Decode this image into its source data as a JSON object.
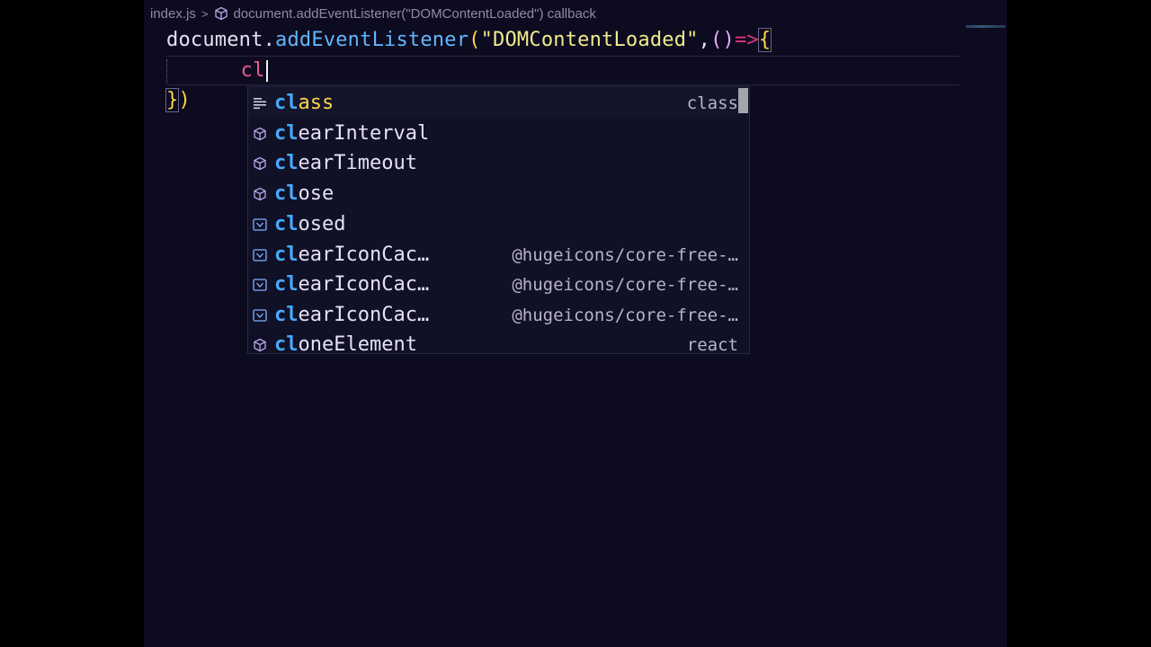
{
  "breadcrumb": {
    "file": "index.js",
    "symbol": "document.addEventListener(\"DOMContentLoaded\") callback"
  },
  "code": {
    "line1": {
      "obj": "document",
      "dot": ".",
      "fn": "addEventListener",
      "open": "(",
      "str": "\"DOMContentLoaded\"",
      "comma": ",",
      "params": "()",
      "arrow": "=>",
      "brace": "{"
    },
    "line2": {
      "typed": "cl"
    },
    "line3": {
      "brace": "}",
      "close": ")"
    }
  },
  "suggestions": [
    {
      "match": "cl",
      "rest": "ass",
      "detail": "class",
      "icon": "keyword-snippet-icon",
      "selected": true
    },
    {
      "match": "cl",
      "rest": "earInterval",
      "detail": "",
      "icon": "method-cube-icon"
    },
    {
      "match": "cl",
      "rest": "earTimeout",
      "detail": "",
      "icon": "method-cube-icon"
    },
    {
      "match": "cl",
      "rest": "ose",
      "detail": "",
      "icon": "method-cube-icon"
    },
    {
      "match": "cl",
      "rest": "osed",
      "detail": "",
      "icon": "variable-icon"
    },
    {
      "match": "cl",
      "rest": "earIconCac…",
      "detail": "@hugeicons/core-free-…",
      "icon": "variable-icon"
    },
    {
      "match": "cl",
      "rest": "earIconCac…",
      "detail": "@hugeicons/core-free-…",
      "icon": "variable-icon"
    },
    {
      "match": "cl",
      "rest": "earIconCac…",
      "detail": "@hugeicons/core-free-…",
      "icon": "variable-icon"
    },
    {
      "match": "cl",
      "rest": "oneElement",
      "detail": "react",
      "icon": "method-cube-icon"
    }
  ],
  "colors": {
    "editor_bg": "#0d0b1f",
    "function": "#61b6ff",
    "string": "#f0ea8f",
    "match_highlight": "#48a9ff",
    "brace": "#ffd54a"
  }
}
